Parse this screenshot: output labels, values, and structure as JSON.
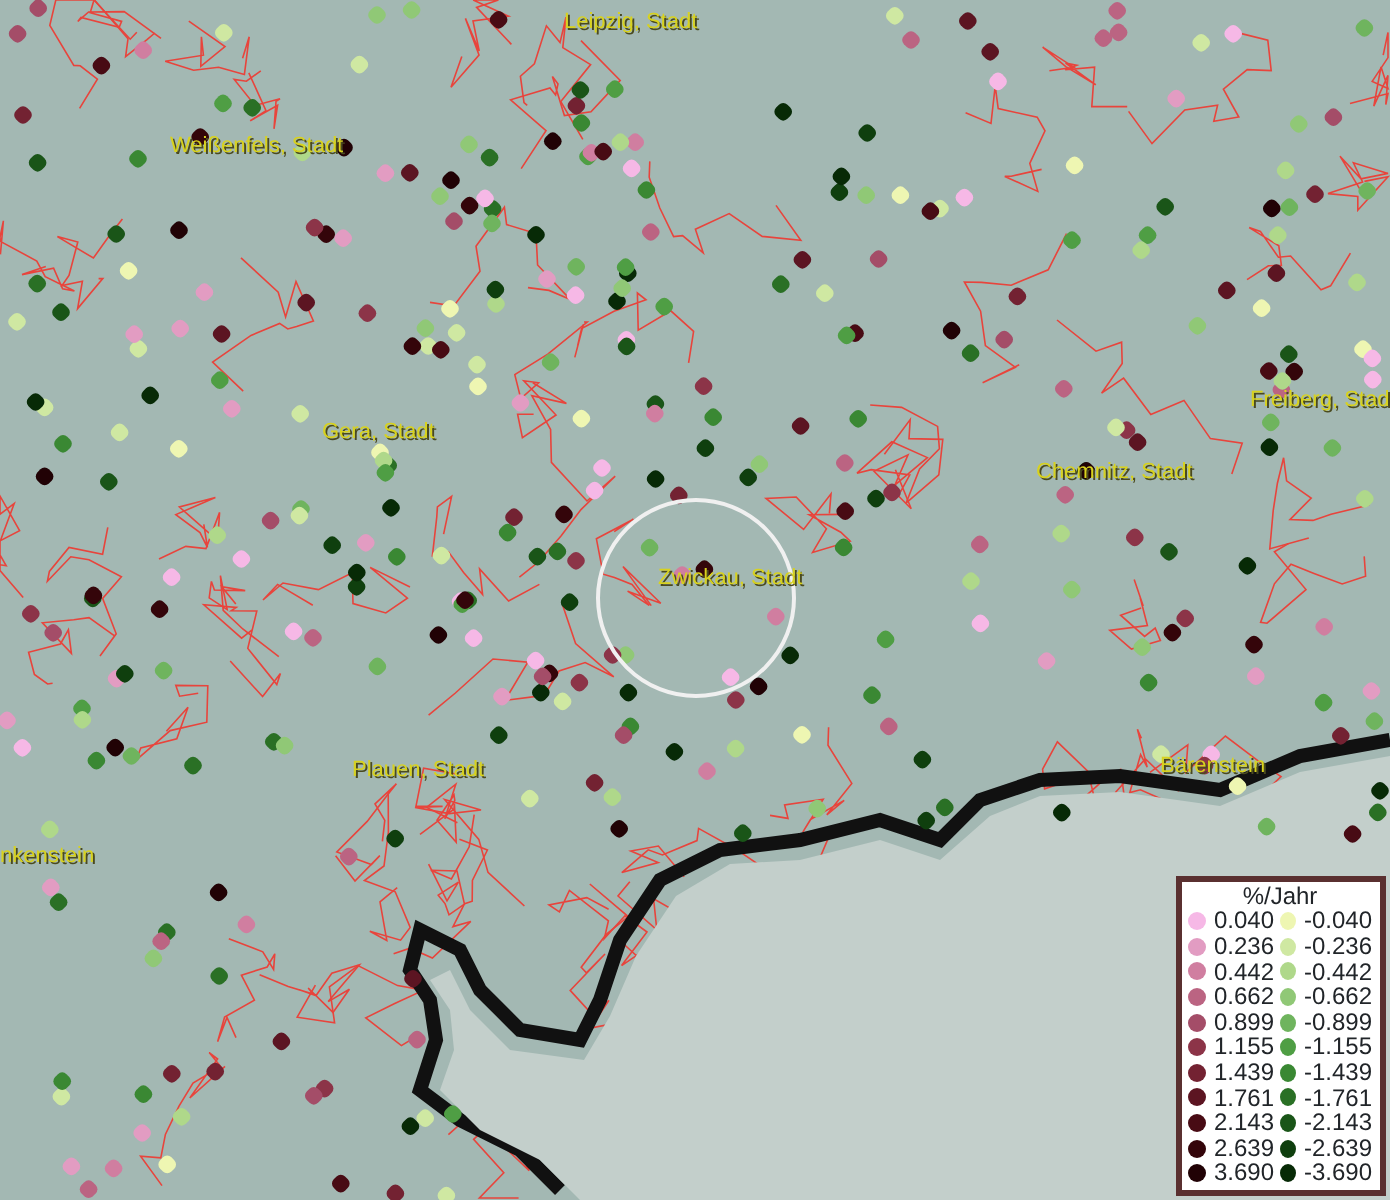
{
  "map": {
    "places": [
      {
        "name": "Leipzig, Stadt"
      },
      {
        "name": "Weißenfels, Stadt"
      },
      {
        "name": "Gera, Stadt"
      },
      {
        "name": "Chemnitz, Stadt"
      },
      {
        "name": "Freiberg, Stad"
      },
      {
        "name": "Zwickau, Stadt"
      },
      {
        "name": "Plauen, Stadt"
      },
      {
        "name": "Bärenstein"
      },
      {
        "name": "nkenstein"
      }
    ]
  },
  "legend": {
    "title": "%/Jahr",
    "positive": [
      {
        "label": "0.040",
        "color": "#f6b8e6"
      },
      {
        "label": "0.236",
        "color": "#e29cc2"
      },
      {
        "label": "0.442",
        "color": "#d07ea0"
      },
      {
        "label": "0.662",
        "color": "#bb6482"
      },
      {
        "label": "0.899",
        "color": "#a44d68"
      },
      {
        "label": "1.155",
        "color": "#8c3448"
      },
      {
        "label": "1.439",
        "color": "#732232"
      },
      {
        "label": "1.761",
        "color": "#5c1522"
      },
      {
        "label": "2.143",
        "color": "#480b14"
      },
      {
        "label": "2.639",
        "color": "#34050a"
      },
      {
        "label": "3.690",
        "color": "#210205"
      }
    ],
    "negative": [
      {
        "label": "-0.040",
        "color": "#eef6b2"
      },
      {
        "label": "-0.236",
        "color": "#cfe8a2"
      },
      {
        "label": "-0.442",
        "color": "#afd88a"
      },
      {
        "label": "-0.662",
        "color": "#90c876"
      },
      {
        "label": "-0.899",
        "color": "#6fb45e"
      },
      {
        "label": "-1.155",
        "color": "#4f9e44"
      },
      {
        "label": "-1.439",
        "color": "#3a8833"
      },
      {
        "label": "-1.761",
        "color": "#2a7025"
      },
      {
        "label": "-2.143",
        "color": "#1a5518"
      },
      {
        "label": "-2.639",
        "color": "#0f3f0e"
      },
      {
        "label": "-3.690",
        "color": "#072a06"
      }
    ]
  }
}
